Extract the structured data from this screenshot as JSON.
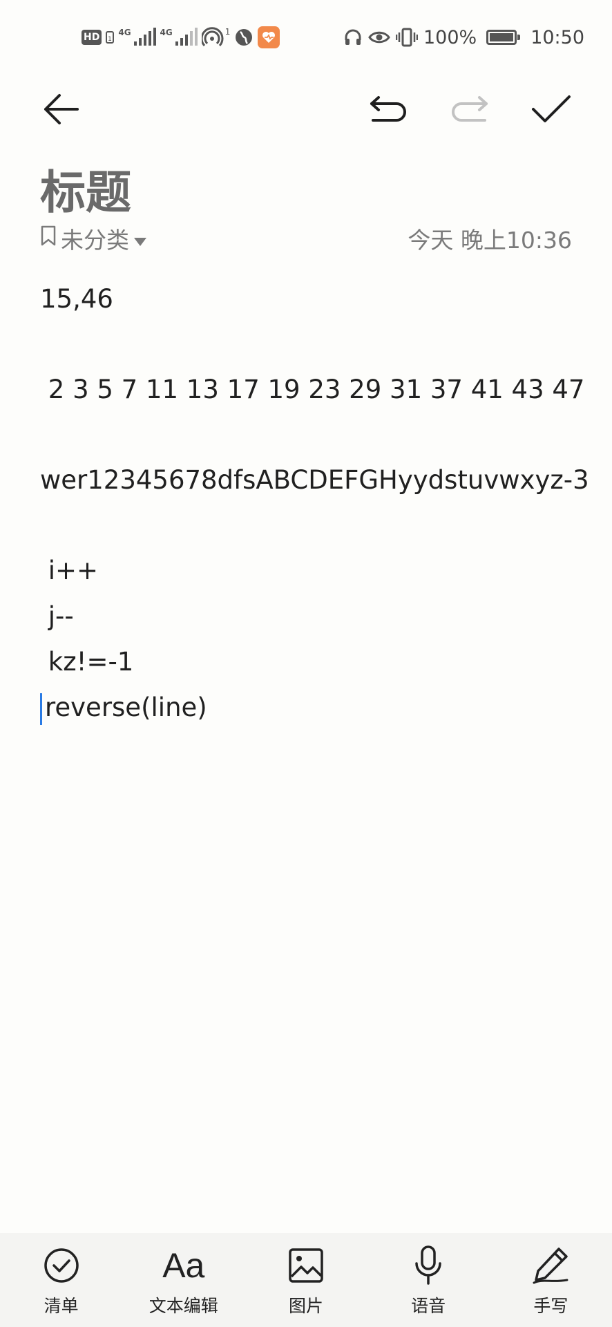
{
  "status_bar": {
    "hd": "HD",
    "net1": "4G",
    "net2": "4G",
    "hotspot_count": "1",
    "battery": "100%",
    "time": "10:50"
  },
  "note": {
    "title": "标题",
    "category": "未分类",
    "timestamp": "今天 晚上10:36",
    "lines": [
      "15,46",
      "",
      " 2 3 5 7 11 13 17 19 23 29 31 37 41 43 47",
      "",
      "wer12345678dfsABCDEFGHyydstuvwxyz-3",
      "",
      " i++",
      " j--",
      " kz!=-1",
      "reverse(line)"
    ]
  },
  "bottom_bar": {
    "checklist": "清单",
    "text_edit": "文本编辑",
    "text_edit_icon": "Aa",
    "image": "图片",
    "voice": "语音",
    "handwrite": "手写"
  },
  "icons": {
    "back": "arrow-left-icon",
    "undo": "undo-icon",
    "redo": "redo-icon",
    "confirm": "check-icon"
  },
  "colors": {
    "accent_cursor": "#2a7be4",
    "health_app": "#f2894a",
    "disabled": "#bdbdbd"
  }
}
